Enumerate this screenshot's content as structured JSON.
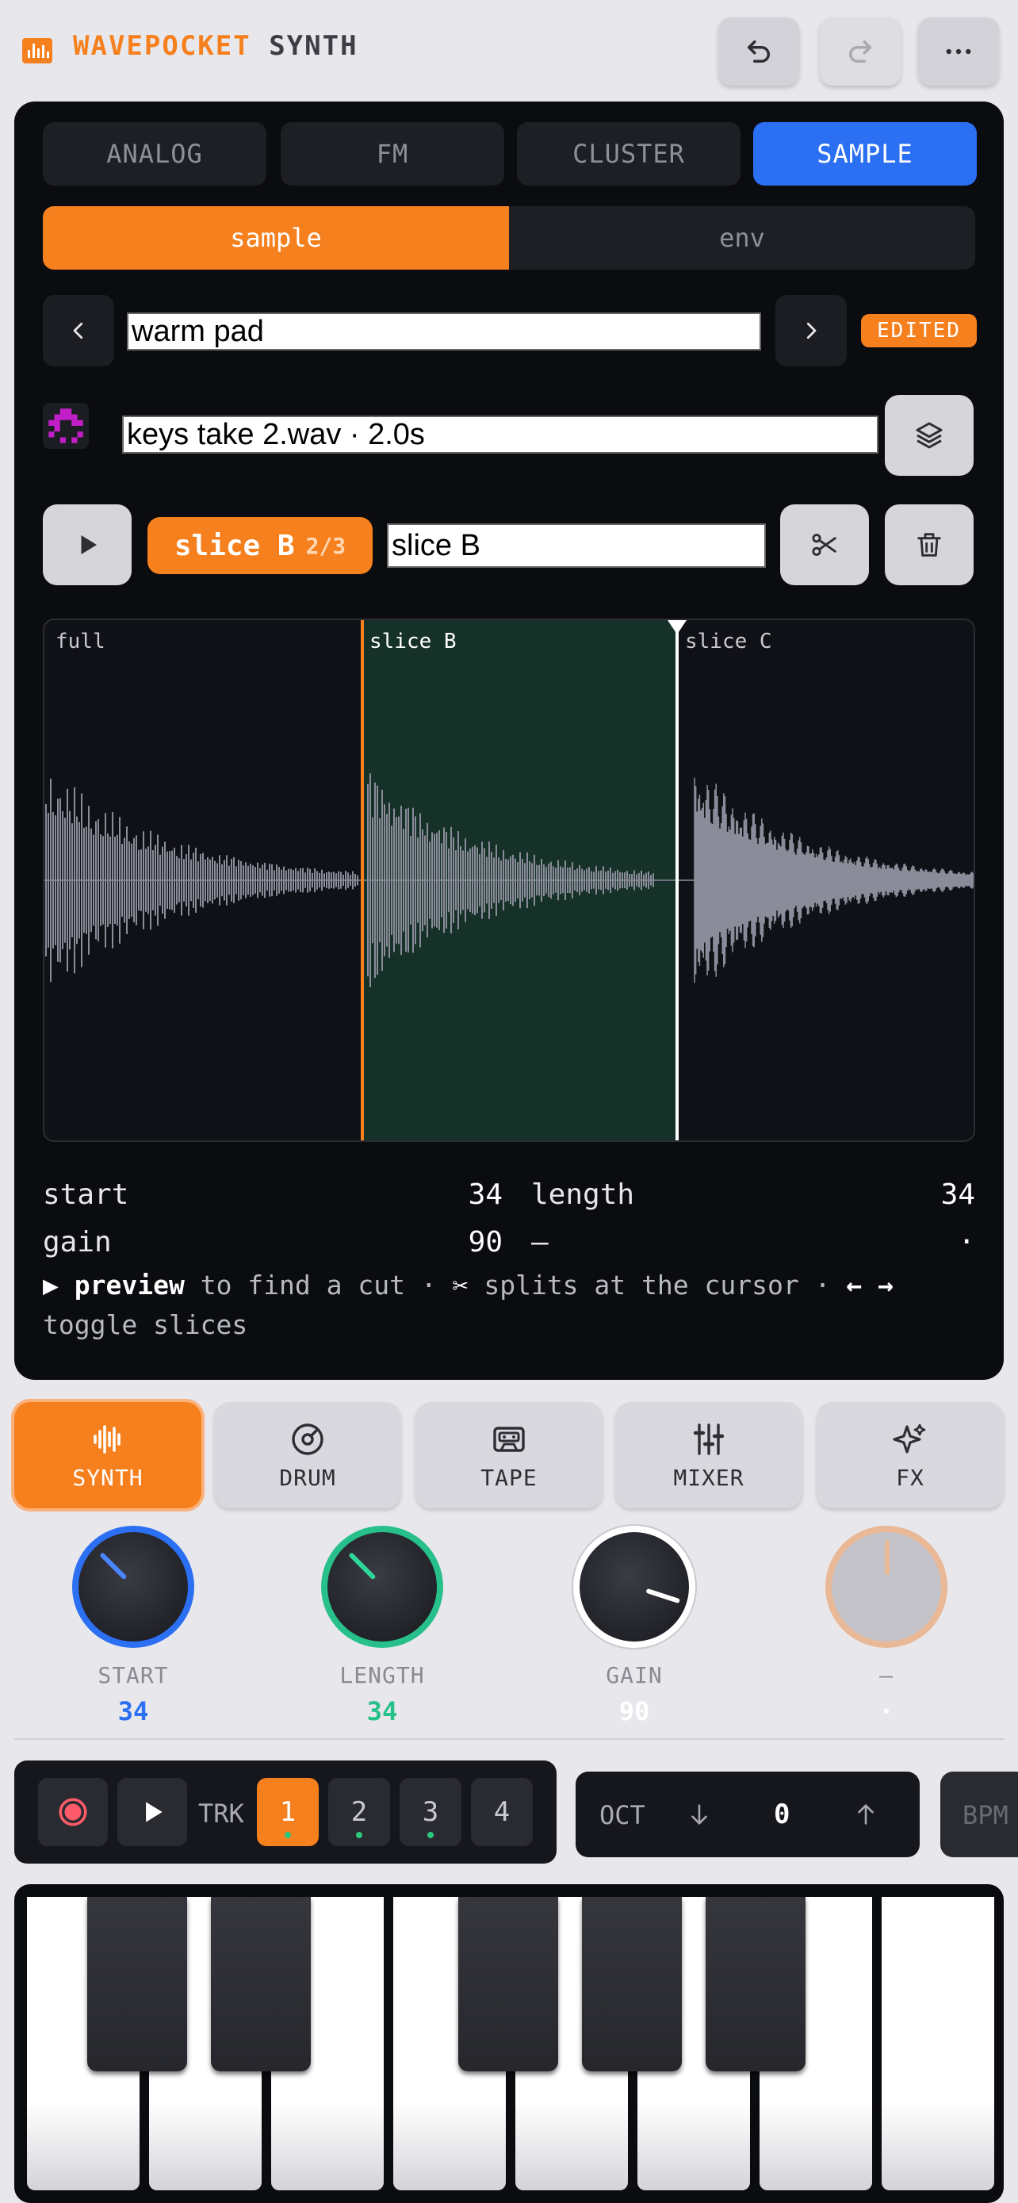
{
  "header": {
    "brand_primary": "WAVEPOCKET",
    "brand_secondary": "SYNTH",
    "undo_icon": "undo-icon",
    "redo_icon": "redo-icon",
    "more_icon": "more-icon"
  },
  "engine_tabs": [
    "ANALOG",
    "FM",
    "CLUSTER",
    "SAMPLE"
  ],
  "active_engine": "SAMPLE",
  "sub_tabs": [
    "sample",
    "env"
  ],
  "active_sub_tab": "sample",
  "preset": {
    "name": "warm pad",
    "status": "EDITED"
  },
  "sample_file": "keys take 2.wav · 2.0s",
  "slice": {
    "chip_label": "slice B",
    "chip_count": "2/3",
    "name": "slice B"
  },
  "waveform": {
    "slices": [
      "full",
      "slice B",
      "slice C"
    ]
  },
  "params": {
    "start_label": "start",
    "start_value": "34",
    "length_label": "length",
    "length_value": "34",
    "gain_label": "gain",
    "gain_value": "90",
    "empty_label": "—",
    "empty_value": "·"
  },
  "hint": {
    "arrow": "▶",
    "preview": "preview",
    "t1": "to find a cut ·",
    "scissors": "✂",
    "t2": "splits at the cursor ·",
    "arrows": "← →",
    "t3": "toggle slices"
  },
  "mode_tabs": [
    "SYNTH",
    "DRUM",
    "TAPE",
    "MIXER",
    "FX"
  ],
  "active_mode": "SYNTH",
  "knobs": [
    {
      "label": "START",
      "value": "34",
      "color": "#2b6ff3"
    },
    {
      "label": "LENGTH",
      "value": "34",
      "color": "#27c08a"
    },
    {
      "label": "GAIN",
      "value": "90",
      "color": "#ffffff"
    },
    {
      "label": "—",
      "value": "·",
      "color": "#e9b896"
    }
  ],
  "transport": {
    "trk_label": "TRK",
    "tracks": [
      "1",
      "2",
      "3",
      "4"
    ],
    "active_track": "1"
  },
  "octave": {
    "label": "OCT",
    "value": "0"
  },
  "bpm_label": "BPM",
  "colors": {
    "accent": "#f6801e",
    "blue": "#2b6ff3",
    "green": "#27c08a",
    "slice_highlight": "#163128"
  }
}
